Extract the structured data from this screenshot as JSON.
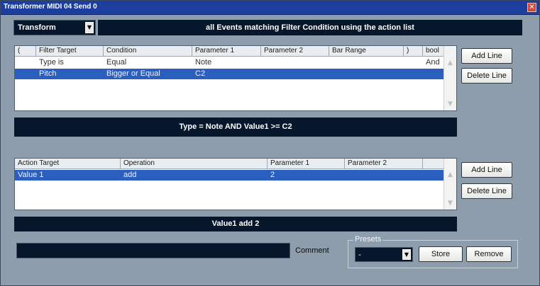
{
  "window": {
    "title": "Transformer MIDI 04 Send 0",
    "close_glyph": "✕"
  },
  "header": {
    "mode_value": "Transform",
    "description": "all Events matching Filter Condition using the action list"
  },
  "filter_table": {
    "columns": [
      "(",
      "Filter Target",
      "Condition",
      "Parameter 1",
      "Parameter 2",
      "Bar Range",
      ")",
      "bool"
    ],
    "rows": [
      {
        "paren_open": "",
        "target": "Type is",
        "condition": "Equal",
        "param1": "Note",
        "param2": "",
        "bar_range": "",
        "paren_close": "",
        "bool": "And",
        "selected": false
      },
      {
        "paren_open": "",
        "target": "Pitch",
        "condition": "Bigger or Equal",
        "param1": "C2",
        "param2": "",
        "bar_range": "",
        "paren_close": "",
        "bool": "",
        "selected": true
      }
    ],
    "add_label": "Add Line",
    "delete_label": "Delete Line",
    "summary": "Type = Note  AND   Value1 >= C2"
  },
  "action_table": {
    "columns": [
      "Action Target",
      "Operation",
      "Parameter 1",
      "Parameter 2",
      ""
    ],
    "rows": [
      {
        "target": "Value 1",
        "operation": "add",
        "param1": "2",
        "param2": "",
        "selected": true
      }
    ],
    "add_label": "Add Line",
    "delete_label": "Delete Line",
    "summary": "Value1 add 2"
  },
  "footer": {
    "comment_value": "",
    "comment_label": "Comment",
    "presets_label": "Presets",
    "preset_value": "-",
    "store_label": "Store",
    "remove_label": "Remove"
  },
  "colors": {
    "window_bg": "#8d9dac",
    "titlebar": "#1c3e9c",
    "dark_field": "#06162b",
    "selection": "#2a5fbf"
  },
  "icons": {
    "dropdown": "chevron-down-icon",
    "scroll_up": "scroll-up-icon",
    "scroll_down": "scroll-down-icon",
    "close": "close-icon"
  }
}
